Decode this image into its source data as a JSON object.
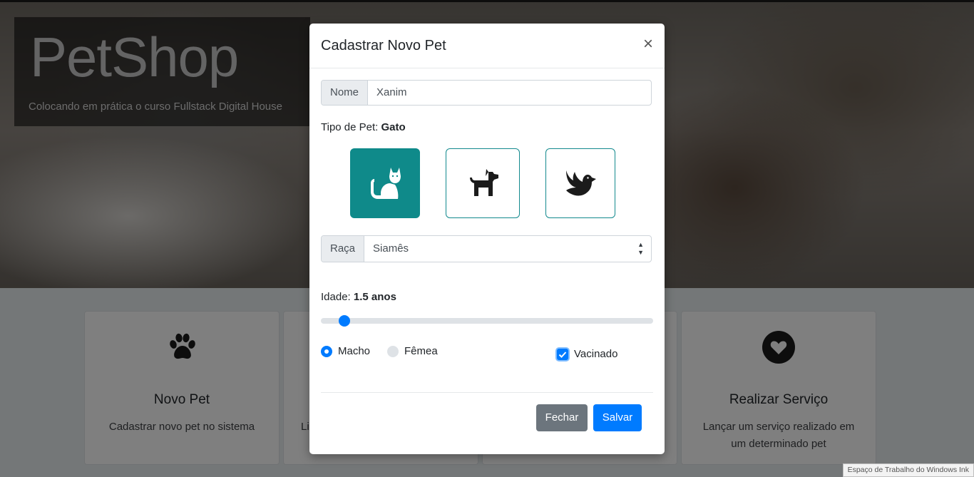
{
  "page": {
    "title": "PetShop",
    "subtitle": "Colocando em prática o curso Fullstack Digital House"
  },
  "cards": [
    {
      "title": "Novo Pet",
      "text": "Cadastrar novo pet no sistema",
      "icon": "paw-icon"
    },
    {
      "title": "",
      "text": "Li",
      "icon": ""
    },
    {
      "title": "",
      "text": "",
      "icon": ""
    },
    {
      "title": "Realizar Serviço",
      "text": "Lançar um serviço realizado em um determinado pet",
      "icon": "heart-icon"
    }
  ],
  "modal": {
    "title": "Cadastrar Novo Pet",
    "close_symbol": "×",
    "nome_label": "Nome",
    "nome_value": "Xanim",
    "tipo_label": "Tipo de Pet:",
    "tipo_value": "Gato",
    "pet_types": [
      {
        "name": "cat",
        "icon": "cat-icon",
        "selected": true
      },
      {
        "name": "dog",
        "icon": "dog-icon",
        "selected": false
      },
      {
        "name": "bird",
        "icon": "dove-icon",
        "selected": false
      }
    ],
    "raca_label": "Raça",
    "raca_value": "Siamês",
    "idade_label": "Idade:",
    "idade_value": "1.5 anos",
    "sexo_options": [
      {
        "label": "Macho",
        "checked": true
      },
      {
        "label": "Fêmea",
        "checked": false
      }
    ],
    "vacinado_label": "Vacinado",
    "vacinado_checked": true,
    "fechar_label": "Fechar",
    "salvar_label": "Salvar"
  },
  "taskbar_hint": "Espaço de Trabalho do Windows Ink",
  "colors": {
    "accent": "#007bff",
    "pet_selected": "#0f8a8a",
    "secondary": "#6c757d"
  }
}
